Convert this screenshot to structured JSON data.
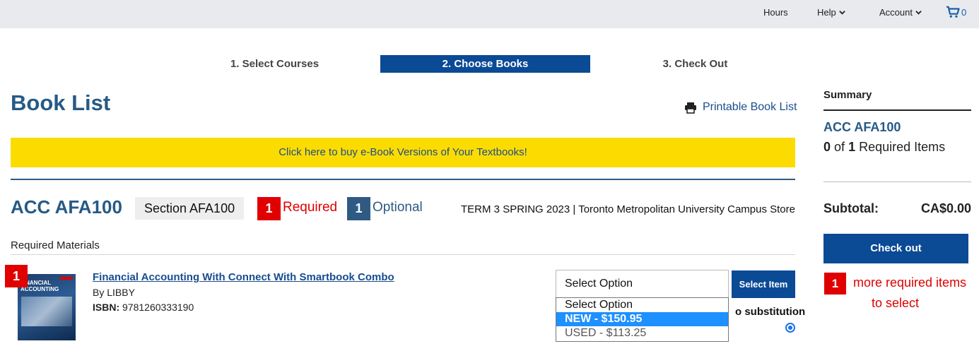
{
  "topbar": {
    "hours": "Hours",
    "help": "Help",
    "account": "Account",
    "cart_count": "0",
    "chevron": "⌄"
  },
  "steps": [
    {
      "label": "1. Select Courses",
      "active": false
    },
    {
      "label": "2. Choose Books",
      "active": true
    },
    {
      "label": "3. Check Out",
      "active": false
    }
  ],
  "page": {
    "title": "Book List",
    "printable": "Printable Book List",
    "ebook_banner": "Click here to buy e-Book Versions of Your Textbooks!"
  },
  "course": {
    "code": "ACC AFA100",
    "section": "Section AFA100",
    "required_count": "1",
    "required_label": "Required",
    "optional_count": "1",
    "optional_label": "Optional",
    "term": "TERM 3 SPRING 2023 | Toronto Metropolitan University Campus Store"
  },
  "materials": {
    "heading": "Required Materials",
    "item_number": "1",
    "book": {
      "title": "Financial Accounting With Connect With Smartbook Combo",
      "author": "By LIBBY",
      "isbn_label": "ISBN:",
      "isbn": "9781260333190",
      "cover_text": "FINANCIAL ACCOUNTING"
    },
    "select": {
      "value": "Select Option",
      "options": [
        "Select Option",
        "NEW - $150.95",
        "USED - $113.25"
      ],
      "highlighted_index": 1
    },
    "select_item_button": "Select Item",
    "substitution_label": "o substitution"
  },
  "summary": {
    "title": "Summary",
    "course": "ACC AFA100",
    "selected": "0",
    "of": "of",
    "required_total": "1",
    "required_items": "Required Items",
    "subtotal_label": "Subtotal:",
    "subtotal_value": "CA$0.00",
    "checkout": "Check out",
    "more_count": "1",
    "more_line1": "more required items",
    "more_line2": "to select"
  },
  "colors": {
    "brand_blue": "#0b4a95",
    "heading_blue": "#265a86",
    "alert_red": "#e00000",
    "banner_yellow": "#fcdc00",
    "topbar_grey": "#e8eaed"
  },
  "icons": [
    "chevron-down-icon",
    "cart-icon",
    "printer-icon",
    "radio-selected-icon"
  ]
}
